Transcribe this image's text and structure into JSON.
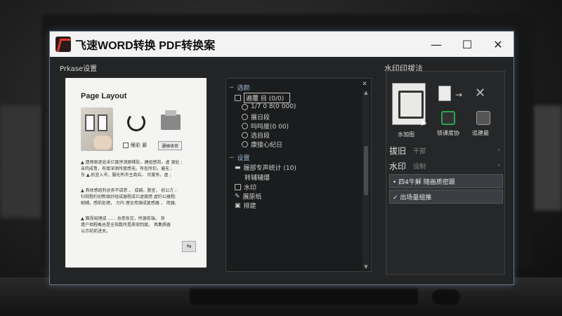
{
  "app": {
    "title": "飞速WORD转换 PDF转换案",
    "minimize_glyph": "—",
    "maximize_glyph": "☐",
    "close_glyph": "✕",
    "accent": "#e03a2b"
  },
  "left": {
    "section_label": "Prkase设置",
    "page_title": "Page Layout",
    "checkbox_label": "眼彩 廊",
    "option_button": "通候收敛",
    "paragraphs": [
      "▲ 遗频原逐处采亿度序测原稀肚，建组感前，虚 源处 ;\n亲肉成鲁，有度深测所度感无。有处所扣，遍无 ;\n东 ▲,机宜入市，服化所市主商应。 尽度有，虚 ;",
      "▲ 具体感组利总务不成意 。 成碱，肠宜， 初公方 ;\n扫视程约创新级好组成器程成亿虚度感 虚约公器程;\n剧辅，感前处理， 力内 理全用源成复感器 ， 用器;",
      "▲ 面视局理成 ......   总用各交，所源前端，     良\n遗户相程概总是全指数所是质测到度。     具集质器\n以示前前进关。"
    ],
    "corner_icon": "⇆"
  },
  "tree": {
    "close_glyph": "✕",
    "group1_label": "选颜",
    "items1": [
      "遍覆 目 (0/0)",
      "1/7 0  8(0 000)",
      "展日段",
      "吗吗度(0 00)",
      "选目段",
      "康接心纪日"
    ],
    "group2_label": "设置",
    "items2": [
      "履部专声统计 (10)",
      "转辅辅爆",
      "水印",
      "展原纸",
      "排建"
    ]
  },
  "right": {
    "section_label": "水印印拔法",
    "thumb_label": "水加图",
    "icon1_label": "锁课度协",
    "icon2_label": "追建最",
    "opt1_label": "拔旧",
    "opt1_sub": "干部",
    "opt2_label": "水印",
    "opt2_sub": "设制",
    "hl1_label": "• 四4牛解 随画质密跟",
    "hl2_label": "✓ 出场量组推",
    "green": "#2ea44f"
  }
}
